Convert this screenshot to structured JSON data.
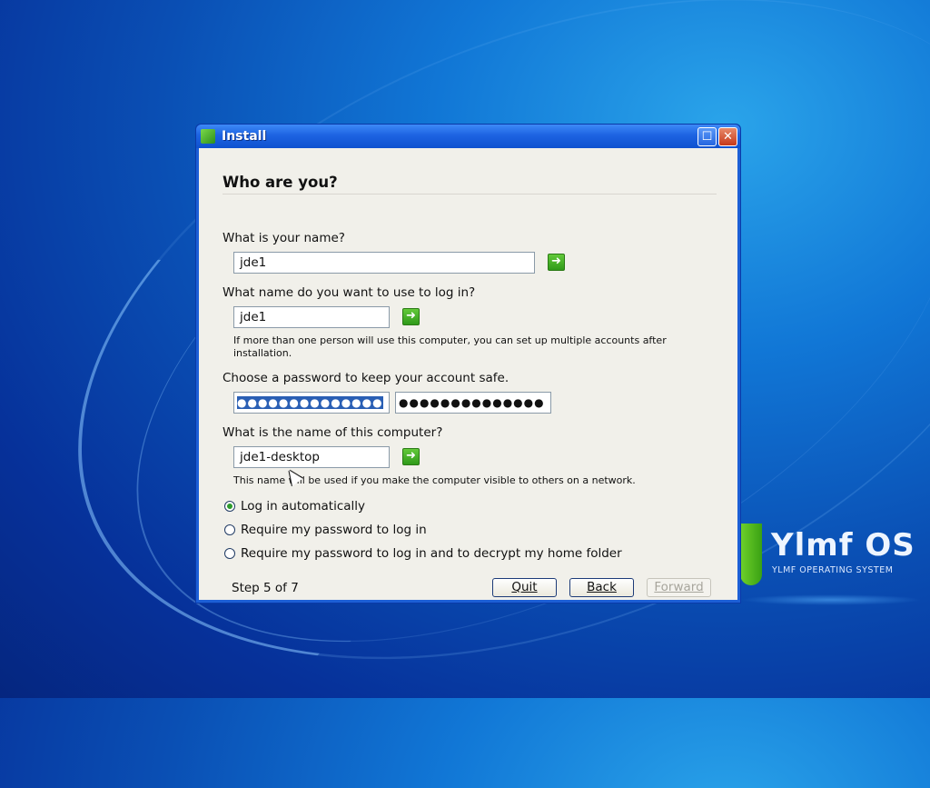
{
  "window": {
    "title": "Install"
  },
  "page": {
    "heading": "Who are you?"
  },
  "name_section": {
    "label": "What is your name?",
    "value": "jde1"
  },
  "login_section": {
    "label": "What name do you want to use to log in?",
    "value": "jde1",
    "note": "If more than one person will use this computer, you can set up multiple accounts after installation."
  },
  "password_section": {
    "label": "Choose a password to keep your account safe.",
    "password_mask": "●●●●●●●●●●●●●●",
    "confirm_mask": "●●●●●●●●●●●●●●"
  },
  "computer_section": {
    "label": "What is the name of this computer?",
    "value": "jde1-desktop",
    "note": "This name will be used if you make the computer visible to others on a network."
  },
  "login_options": [
    {
      "label": "Log in automatically",
      "selected": true
    },
    {
      "label": "Require my password to log in",
      "selected": false
    },
    {
      "label": "Require my password to log in and to decrypt my home folder",
      "selected": false
    }
  ],
  "footer": {
    "step": "Step 5 of 7",
    "quit": "Quit",
    "back": "Back",
    "forward": "Forward"
  },
  "branding": {
    "name": "Ylmf OS",
    "subtitle": "YLMF OPERATING SYSTEM"
  },
  "colors": {
    "titlebar": "#1d63e2",
    "dialog_bg": "#f1f0ea",
    "go_button": "#3aa11e",
    "desktop": "#0a4fb4"
  }
}
